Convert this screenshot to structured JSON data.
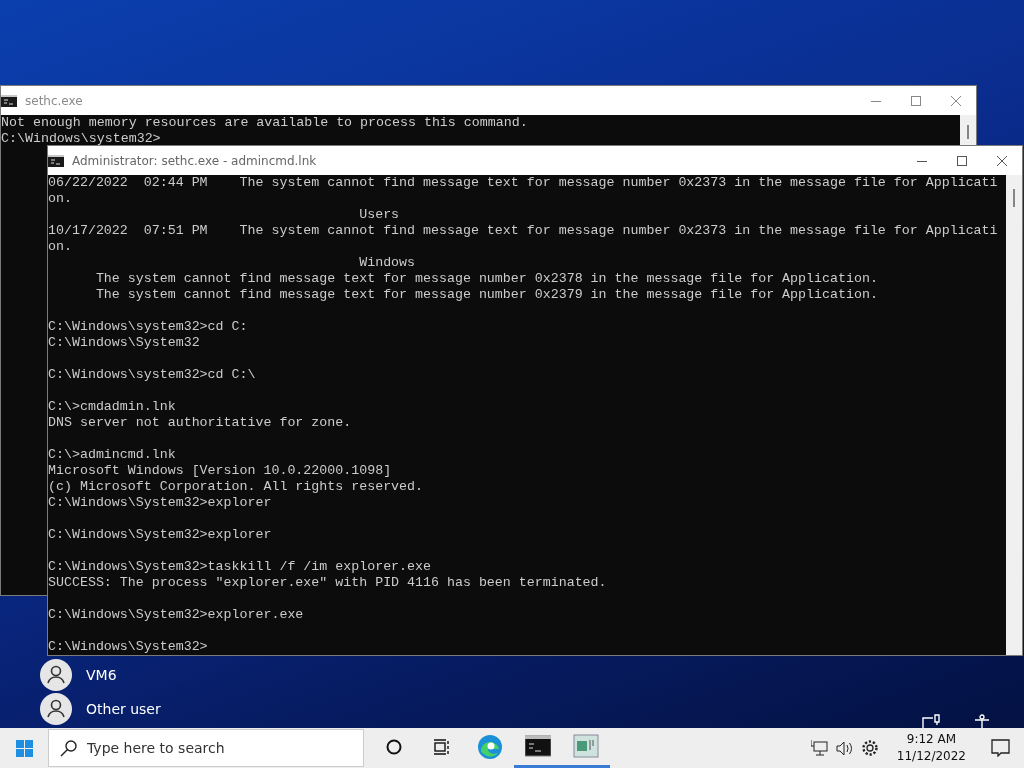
{
  "login_users": [
    {
      "name": "VM6"
    },
    {
      "name": "Other user"
    }
  ],
  "windows": [
    {
      "title": "sethc.exe",
      "active": false,
      "blocks": [
        [
          "Not enough memory resources are available to process this command.",
          "C:\\Windows\\system32>"
        ]
      ]
    },
    {
      "title": "Administrator: sethc.exe - admincmd.lnk",
      "active": true,
      "blocks": [
        [
          "06/22/2022  02:44 PM    The system cannot find message text for message number 0x2373 in the message file for Applicati",
          "on.",
          "                                       Users",
          "10/17/2022  07:51 PM    The system cannot find message text for message number 0x2373 in the message file for Applicati",
          "on.",
          "                                       Windows",
          "      The system cannot find message text for message number 0x2378 in the message file for Application.",
          "      The system cannot find message text for message number 0x2379 in the message file for Application."
        ],
        [
          "C:\\Windows\\system32>cd C:",
          "C:\\Windows\\System32"
        ],
        [
          "C:\\Windows\\system32>cd C:\\"
        ],
        [
          "C:\\>cmdadmin.lnk",
          "DNS server not authoritative for zone."
        ],
        [
          "C:\\>admincmd.lnk",
          "Microsoft Windows [Version 10.0.22000.1098]",
          "(c) Microsoft Corporation. All rights reserved.",
          "C:\\Windows\\System32>explorer"
        ],
        [
          "C:\\Windows\\System32>explorer"
        ],
        [
          "C:\\Windows\\System32>taskkill /f /im explorer.exe",
          "SUCCESS: The process \"explorer.exe\" with PID 4116 has been terminated."
        ],
        [
          "C:\\Windows\\System32>explorer.exe"
        ],
        [
          "C:\\Windows\\System32>"
        ]
      ]
    }
  ],
  "taskbar": {
    "search": {
      "placeholder": "Type here to search"
    },
    "apps": [
      {
        "kind": "edge",
        "running": false
      },
      {
        "kind": "console",
        "running": true
      },
      {
        "kind": "window",
        "running": true
      }
    ],
    "clock": {
      "time": "9:12 AM",
      "date": "11/12/2022"
    }
  }
}
